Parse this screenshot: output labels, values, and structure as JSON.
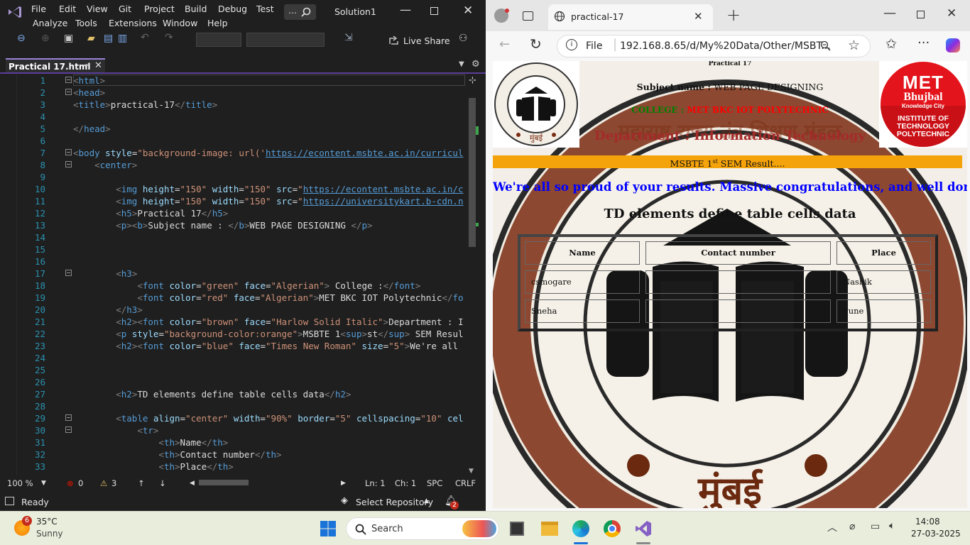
{
  "vs": {
    "menu": [
      "File",
      "Edit",
      "View",
      "Git",
      "Project",
      "Build",
      "Debug",
      "Test",
      "Analyze",
      "Tools",
      "Extensions",
      "Window",
      "Help"
    ],
    "solution": "Solution1",
    "live_share": "Live Share",
    "tab_title": "Practical 17.html",
    "lines": [
      {
        "n": "1",
        "html": "<span class='t'>&lt;</span><span class='tn'>html</span><span class='t'>&gt;</span>"
      },
      {
        "n": "2",
        "html": "<span class='t'>&lt;</span><span class='tn'>head</span><span class='t'>&gt;</span>"
      },
      {
        "n": "3",
        "html": "<span class='t'>&lt;</span><span class='tn'>title</span><span class='t'>&gt;</span><span class='tx'>practical-17</span><span class='t'>&lt;/</span><span class='tn'>title</span><span class='t'>&gt;</span>"
      },
      {
        "n": "4",
        "html": ""
      },
      {
        "n": "5",
        "html": "<span class='t'>&lt;/</span><span class='tn'>head</span><span class='t'>&gt;</span>"
      },
      {
        "n": "6",
        "html": ""
      },
      {
        "n": "7",
        "html": "<span class='t'>&lt;</span><span class='tn'>body</span> <span class='at'>style</span><span class='tx'>=</span><span class='av'>\"background-image: url('</span><span class='av2'>https://econtent.msbte.ac.in/curricul</span>"
      },
      {
        "n": "8",
        "html": "    <span class='t'>&lt;</span><span class='tn'>center</span><span class='t'>&gt;</span>"
      },
      {
        "n": "9",
        "html": ""
      },
      {
        "n": "10",
        "html": "        <span class='t'>&lt;</span><span class='tn'>img</span> <span class='at'>height</span><span class='tx'>=</span><span class='av'>\"150\"</span> <span class='at'>width</span><span class='tx'>=</span><span class='av'>\"150\"</span> <span class='at'>src</span><span class='tx'>=</span><span class='av'>\"</span><span class='av2'>https://econtent.msbte.ac.in/c</span>"
      },
      {
        "n": "11",
        "html": "        <span class='t'>&lt;</span><span class='tn'>img</span> <span class='at'>height</span><span class='tx'>=</span><span class='av'>\"150\"</span> <span class='at'>width</span><span class='tx'>=</span><span class='av'>\"150\"</span> <span class='at'>src</span><span class='tx'>=</span><span class='av'>\"</span><span class='av2'>https://universitykart.b-cdn.n</span>"
      },
      {
        "n": "12",
        "html": "        <span class='t'>&lt;</span><span class='tn'>h5</span><span class='t'>&gt;</span><span class='tx'>Practical 17</span><span class='t'>&lt;/</span><span class='tn'>h5</span><span class='t'>&gt;</span>"
      },
      {
        "n": "13",
        "html": "        <span class='t'>&lt;</span><span class='tn'>p</span><span class='t'>&gt;&lt;</span><span class='tn'>b</span><span class='t'>&gt;</span><span class='tx'>Subject name : </span><span class='t'>&lt;/</span><span class='tn'>b</span><span class='t'>&gt;</span><span class='tx'>WEB PAGE DESIGNING </span><span class='t'>&lt;/</span><span class='tn'>p</span><span class='t'>&gt;</span>"
      },
      {
        "n": "14",
        "html": ""
      },
      {
        "n": "15",
        "html": ""
      },
      {
        "n": "16",
        "html": ""
      },
      {
        "n": "17",
        "html": "        <span class='t'>&lt;</span><span class='tn'>h3</span><span class='t'>&gt;</span>"
      },
      {
        "n": "18",
        "html": "            <span class='t'>&lt;</span><span class='tn'>font</span> <span class='at'>color</span><span class='tx'>=</span><span class='av'>\"green\"</span> <span class='at'>face</span><span class='tx'>=</span><span class='av'>\"Algerian\"</span><span class='t'>&gt;</span><span class='tx'> College :</span><span class='t'>&lt;/</span><span class='tn'>font</span><span class='t'>&gt;</span>"
      },
      {
        "n": "19",
        "html": "            <span class='t'>&lt;</span><span class='tn'>font</span> <span class='at'>color</span><span class='tx'>=</span><span class='av'>\"red\"</span> <span class='at'>face</span><span class='tx'>=</span><span class='av'>\"Algerian\"</span><span class='t'>&gt;</span><span class='tx'>MET BKC IOT Polytechnic</span><span class='t'>&lt;/</span><span class='tn'>fo</span>"
      },
      {
        "n": "20",
        "html": "        <span class='t'>&lt;/</span><span class='tn'>h3</span><span class='t'>&gt;</span>"
      },
      {
        "n": "21",
        "html": "        <span class='t'>&lt;</span><span class='tn'>h2</span><span class='t'>&gt;&lt;</span><span class='tn'>font</span> <span class='at'>color</span><span class='tx'>=</span><span class='av'>\"brown\"</span> <span class='at'>face</span><span class='tx'>=</span><span class='av'>\"Harlow Solid Italic\"</span><span class='t'>&gt;</span><span class='tx'>Department : I</span>"
      },
      {
        "n": "22",
        "html": "        <span class='t'>&lt;</span><span class='tn'>p</span> <span class='at'>style</span><span class='tx'>=</span><span class='av'>\"background-color:orange\"</span><span class='t'>&gt;</span><span class='tx'>MSBTE 1</span><span class='t'>&lt;</span><span class='tn'>sup</span><span class='t'>&gt;</span><span class='tx'>st</span><span class='t'>&lt;/</span><span class='tn'>sup</span><span class='t'>&gt;</span><span class='tx'> SEM Resul</span>"
      },
      {
        "n": "23",
        "html": "        <span class='t'>&lt;</span><span class='tn'>h2</span><span class='t'>&gt;&lt;</span><span class='tn'>font</span> <span class='at'>color</span><span class='tx'>=</span><span class='av'>\"blue\"</span> <span class='at'>face</span><span class='tx'>=</span><span class='av'>\"Times New Roman\"</span> <span class='at'>size</span><span class='tx'>=</span><span class='av'>\"5\"</span><span class='t'>&gt;</span><span class='tx'>We're all</span>"
      },
      {
        "n": "24",
        "html": ""
      },
      {
        "n": "25",
        "html": ""
      },
      {
        "n": "26",
        "html": ""
      },
      {
        "n": "27",
        "html": "        <span class='t'>&lt;</span><span class='tn'>h2</span><span class='t'>&gt;</span><span class='tx'>TD elements define table cells data</span><span class='t'>&lt;/</span><span class='tn'>h2</span><span class='t'>&gt;</span>"
      },
      {
        "n": "28",
        "html": ""
      },
      {
        "n": "29",
        "html": "        <span class='t'>&lt;</span><span class='tn'>table</span> <span class='at'>align</span><span class='tx'>=</span><span class='av'>\"center\"</span> <span class='at'>width</span><span class='tx'>=</span><span class='av'>\"90%\"</span> <span class='at'>border</span><span class='tx'>=</span><span class='av'>\"5\"</span> <span class='at'>cellspacing</span><span class='tx'>=</span><span class='av'>\"10\"</span> <span class='at'>cel</span>"
      },
      {
        "n": "30",
        "html": "            <span class='t'>&lt;</span><span class='tn'>tr</span><span class='t'>&gt;</span>"
      },
      {
        "n": "31",
        "html": "                <span class='t'>&lt;</span><span class='tn'>th</span><span class='t'>&gt;</span><span class='tx'>Name</span><span class='t'>&lt;/</span><span class='tn'>th</span><span class='t'>&gt;</span>"
      },
      {
        "n": "32",
        "html": "                <span class='t'>&lt;</span><span class='tn'>th</span><span class='t'>&gt;</span><span class='tx'>Contact number</span><span class='t'>&lt;/</span><span class='tn'>th</span><span class='t'>&gt;</span>"
      },
      {
        "n": "33",
        "html": "                <span class='t'>&lt;</span><span class='tn'>th</span><span class='t'>&gt;</span><span class='tx'>Place</span><span class='t'>&lt;/</span><span class='tn'>th</span><span class='t'>&gt;</span>"
      },
      {
        "n": "34",
        "html": "            <span class='t'>&lt;/</span><span class='tn'>tr</span><span class='t'>&gt;</span>"
      }
    ],
    "status": {
      "zoom": "100 %",
      "errors": "0",
      "warnings": "3",
      "ln": "Ln: 1",
      "ch": "Ch: 1",
      "spc": "SPC",
      "crlf": "CRLF"
    },
    "ready": "Ready",
    "select_repo": "Select Repository",
    "notif_count": "2"
  },
  "edge": {
    "tab_title": "practical-17",
    "url_scheme": "File",
    "url": "192.168.8.65/d/My%20Data/Other/MSBT...",
    "page": {
      "practical": "Practical 17",
      "subject_label": "Subject name : ",
      "subject_value": "WEB PAGE DESIGNING",
      "college_label": "College :",
      "college_value": "MET BKC IOT Polytechnic",
      "department": "Department : Information Technology",
      "result_prefix": "MSBTE 1",
      "result_sup": "st",
      "result_suffix": " SEM Result....",
      "congrats": "We're all so proud of your results. Massive congratulations, and well done!",
      "table_heading": "TD elements define table cells data",
      "table": {
        "headers": [
          "Name",
          "Contact number",
          "Place"
        ],
        "rows": [
          [
            "csmogare",
            "",
            "Nashik"
          ],
          [
            "Sneha",
            "",
            "Pune"
          ]
        ]
      },
      "met_logo": {
        "l1": "MET",
        "l2": "Bhujbal",
        "l3": "Knowledge City",
        "l4": "INSTITUTE OF",
        "l5": "TECHNOLOGY",
        "l6": "POLYTECHNIC"
      },
      "msbte_seal": {
        "bottom": "मुंबई",
        "top": "महाराष्ट्र राज्य तंत्र शिक्षण मंडळ"
      }
    }
  },
  "taskbar": {
    "weather_temp": "35°C",
    "weather_cond": "Sunny",
    "weather_badge": "6",
    "search": "Search",
    "time": "14:08",
    "date": "27-03-2025"
  },
  "colors": {
    "orange": "#f5a30a",
    "college_green": "#008000",
    "college_red": "#ff0000",
    "dept_brown": "#a52a2a",
    "blue": "#0000ff"
  }
}
